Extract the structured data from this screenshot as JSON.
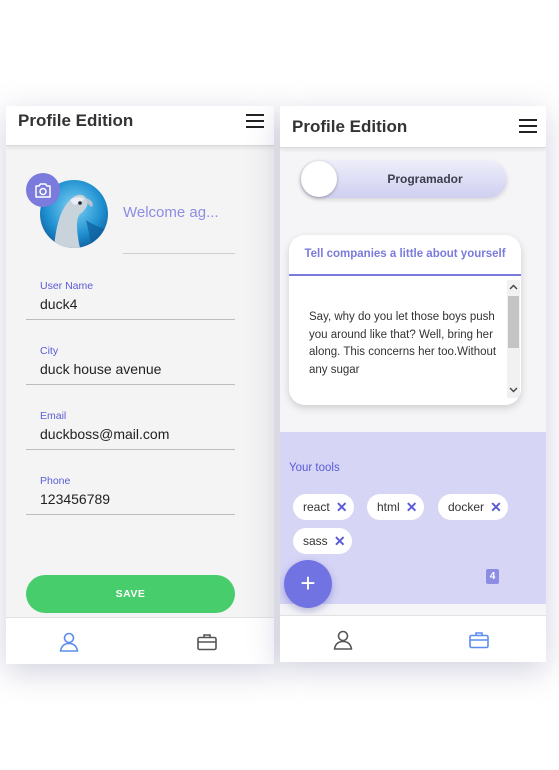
{
  "left": {
    "title": "Profile Edition",
    "welcome": "Welcome ag...",
    "fields": [
      {
        "label": "User Name",
        "value": "duck4"
      },
      {
        "label": "City",
        "value": "duck house avenue"
      },
      {
        "label": "Email",
        "value": "duckboss@mail.com"
      },
      {
        "label": "Phone",
        "value": "123456789"
      }
    ],
    "save_label": "SAVE",
    "nav": [
      "user-icon",
      "briefcase-icon"
    ]
  },
  "right": {
    "title": "Profile Edition",
    "toggle_label": "Programador",
    "about_title": "Tell companies a little about yourself",
    "about_text": "Say, why do you let those boys push you around like that? Well, bring her along. This concerns her too.Without any sugar",
    "tools_title": "Your tools",
    "tools": [
      "react",
      "html",
      "docker",
      "sass"
    ],
    "tools_count": "4",
    "fab_symbol": "+",
    "nav": [
      "user-icon",
      "briefcase-icon"
    ]
  },
  "colors": {
    "accent": "#7a7bdc",
    "save": "#48cd6c",
    "tools_bg": "#d6d5f6",
    "nav_active": "#5b8def",
    "nav_inactive": "#555555"
  }
}
